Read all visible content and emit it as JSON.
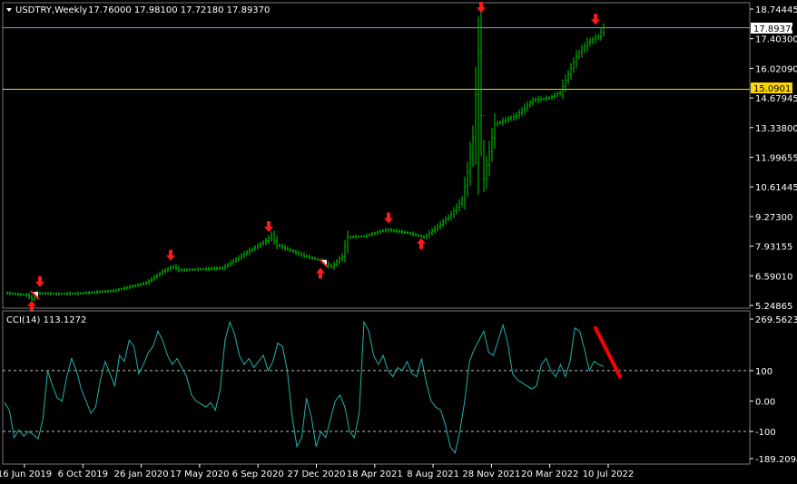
{
  "window": {
    "symbol_title": "USDTRY,Weekly",
    "ohlc": "17.76000 17.98100 17.72180 17.89370",
    "indicator_title": "CCI(14) 113.1272"
  },
  "colors": {
    "background": "#000000",
    "price_bars": "#00c800",
    "cci_line": "#20b2aa",
    "bid_line": "#7f9fbf",
    "horizontal_line": "#ffd700",
    "arrow": "#ff1a1a",
    "trend_line": "#ff0000",
    "axis_text": "#ffffff"
  },
  "chart_data": [
    {
      "type": "ohlc",
      "title": "USDTRY,Weekly",
      "y_ticks": [
        "18.74445",
        "17.40300",
        "16.02090",
        "14.67945",
        "13.33800",
        "11.99655",
        "10.61445",
        "9.27300",
        "7.93155",
        "6.59010",
        "5.24865"
      ],
      "ylim": [
        5.24865,
        18.74445
      ],
      "x_ticks": [
        "16 Jun 2019",
        "6 Oct 2019",
        "26 Jan 2020",
        "17 May 2020",
        "6 Sep 2020",
        "27 Dec 2020",
        "18 Apr 2021",
        "8 Aug 2021",
        "28 Nov 2021",
        "20 Mar 2022",
        "10 Jul 2022"
      ],
      "current_price_label": "17.89370",
      "current_price": 17.8937,
      "horizontal_line_label": "15.09011",
      "horizontal_line_value": 15.09011,
      "close_path": [
        [
          0,
          5.82
        ],
        [
          8,
          5.72
        ],
        [
          10,
          5.55
        ],
        [
          12,
          5.8
        ],
        [
          20,
          5.78
        ],
        [
          28,
          5.8
        ],
        [
          40,
          5.92
        ],
        [
          52,
          6.28
        ],
        [
          58,
          6.8
        ],
        [
          62,
          7.02
        ],
        [
          64,
          6.86
        ],
        [
          72,
          6.9
        ],
        [
          80,
          6.95
        ],
        [
          88,
          7.6
        ],
        [
          96,
          8.2
        ],
        [
          98,
          8.45
        ],
        [
          100,
          8.0
        ],
        [
          104,
          7.8
        ],
        [
          110,
          7.5
        ],
        [
          116,
          7.3
        ],
        [
          120,
          7.0
        ],
        [
          124,
          7.5
        ],
        [
          126,
          8.35
        ],
        [
          132,
          8.4
        ],
        [
          140,
          8.7
        ],
        [
          148,
          8.55
        ],
        [
          154,
          8.35
        ],
        [
          160,
          8.95
        ],
        [
          164,
          9.4
        ],
        [
          168,
          10.05
        ],
        [
          170,
          11.3
        ],
        [
          172,
          12.9
        ],
        [
          174,
          16.8
        ],
        [
          176,
          11.0
        ],
        [
          180,
          13.5
        ],
        [
          188,
          13.9
        ],
        [
          194,
          14.6
        ],
        [
          200,
          14.7
        ],
        [
          204,
          14.95
        ],
        [
          206,
          15.5
        ],
        [
          210,
          16.6
        ],
        [
          214,
          17.2
        ],
        [
          218,
          17.5
        ],
        [
          220,
          17.89
        ]
      ],
      "extreme_bars": [
        {
          "bar": 174,
          "high": 18.4,
          "low": 10.3
        },
        {
          "bar": 176,
          "high": 12.8,
          "low": 10.4
        }
      ],
      "down_arrows": [
        {
          "bar": 13,
          "value": 6.25
        },
        {
          "bar": 61,
          "value": 7.45
        },
        {
          "bar": 97,
          "value": 8.75
        },
        {
          "bar": 141,
          "value": 9.15
        },
        {
          "bar": 175,
          "value": 18.74
        },
        {
          "bar": 217,
          "value": 18.2
        }
      ],
      "up_arrows": [
        {
          "bar": 10,
          "value": 5.3
        },
        {
          "bar": 116,
          "value": 6.8
        },
        {
          "bar": 153,
          "value": 8.15
        }
      ],
      "reversal_marks": [
        {
          "bar": 11,
          "value": 5.7
        },
        {
          "bar": 117,
          "value": 7.15
        }
      ]
    },
    {
      "type": "line",
      "title": "CCI(14) 113.1272",
      "y_ticks": [
        "269.5623",
        "100",
        "0.00",
        "-100",
        "-189.2094"
      ],
      "ylim": [
        -189.2094,
        269.5623
      ],
      "levels": [
        100,
        -100
      ],
      "series": [
        {
          "values": [
            -5,
            -30,
            -120,
            -95,
            -115,
            -100,
            -110,
            -125,
            -60,
            100,
            50,
            10,
            0,
            80,
            140,
            100,
            40,
            0,
            -40,
            -20,
            70,
            130,
            90,
            50,
            150,
            130,
            200,
            180,
            90,
            120,
            160,
            180,
            230,
            200,
            150,
            120,
            140,
            110,
            80,
            20,
            0,
            -10,
            -20,
            -5,
            -30,
            40,
            200,
            260,
            220,
            150,
            120,
            140,
            110,
            130,
            150,
            100,
            130,
            190,
            180,
            100,
            -50,
            -150,
            -120,
            10,
            -50,
            -150,
            -100,
            -120,
            -60,
            0,
            20,
            -20,
            -100,
            -120,
            -40,
            260,
            230,
            150,
            120,
            150,
            100,
            80,
            110,
            100,
            130,
            90,
            80,
            140,
            60,
            0,
            -20,
            -30,
            -80,
            -150,
            -170,
            -100,
            0,
            130,
            170,
            200,
            230,
            160,
            150,
            200,
            250,
            190,
            90,
            70,
            60,
            50,
            40,
            50,
            120,
            140,
            100,
            80,
            120,
            80,
            130,
            240,
            230,
            170,
            100,
            130,
            120,
            113.13
          ]
        }
      ],
      "trend_line": {
        "from": [
          217,
          240
        ],
        "to": [
          226,
          80
        ]
      }
    }
  ]
}
